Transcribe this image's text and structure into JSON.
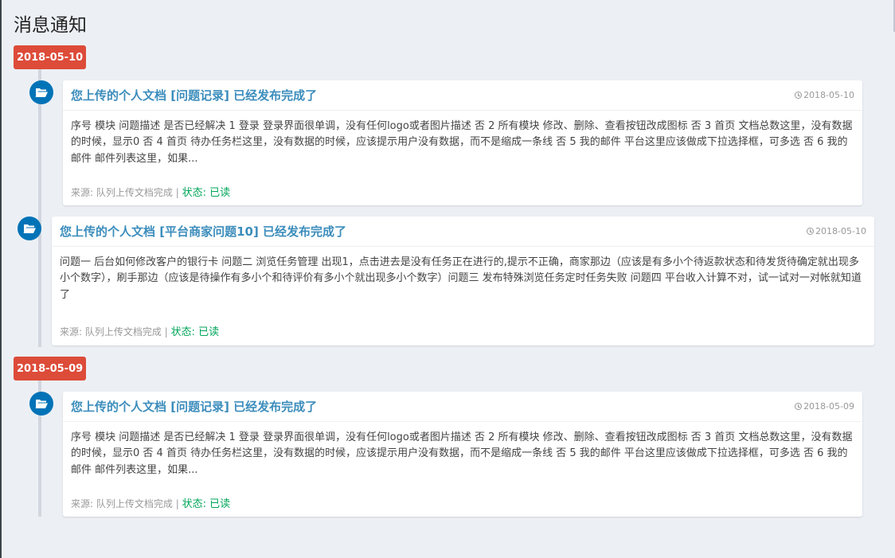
{
  "page": {
    "title": "消息通知"
  },
  "groups": [
    {
      "date": "2018-05-10"
    },
    {
      "date": "2018-05-09"
    }
  ],
  "items": [
    {
      "title": "您上传的个人文档 [问题记录] 已经发布完成了",
      "time": "2018-05-10",
      "body": "序号 模块 问题描述 是否已经解决 1 登录 登录界面很单调，没有任何logo或者图片描述 否 2 所有模块 修改、删除、查看按钮改成图标 否 3 首页 文档总数这里，没有数据的时候，显示0 否 4 首页 待办任务栏这里，没有数据的时候，应该提示用户没有数据，而不是缩成一条线 否 5 我的邮件 平台这里应该做成下拉选择框，可多选 否 6 我的邮件 邮件列表这里，如果...",
      "source": "来源: 队列上传文档完成",
      "separator": "|",
      "status": "状态: 已读"
    },
    {
      "title": "您上传的个人文档 [平台商家问题10] 已经发布完成了",
      "time": "2018-05-10",
      "body": "问题一 后台如何修改客户的银行卡 问题二 浏览任务管理 出现1，点击进去是没有任务正在进行的,提示不正确，商家那边（应该是有多小个待返款状态和待发货待确定就出现多小个数字），刷手那边（应该是待操作有多小个和待评价有多小个就出现多小个数字）问题三 发布特殊浏览任务定时任务失败 问题四 平台收入计算不对，试一试对一对帐就知道了",
      "source": "来源: 队列上传文档完成",
      "separator": "|",
      "status": "状态: 已读"
    },
    {
      "title": "您上传的个人文档 [问题记录] 已经发布完成了",
      "time": "2018-05-09",
      "body": "序号 模块 问题描述 是否已经解决 1 登录 登录界面很单调，没有任何logo或者图片描述 否 2 所有模块 修改、删除、查看按钮改成图标 否 3 首页 文档总数这里，没有数据的时候，显示0 否 4 首页 待办任务栏这里，没有数据的时候，应该提示用户没有数据，而不是缩成一条线 否 5 我的邮件 平台这里应该做成下拉选择框，可多选 否 6 我的邮件 邮件列表这里，如果...",
      "source": "来源: 队列上传文档完成",
      "separator": "|",
      "status": "状态: 已读"
    }
  ],
  "colors": {
    "badge": "#dd4b39",
    "icon": "#0073b7",
    "title": "#3c8dbc",
    "status": "#00a65a"
  },
  "icons": {
    "item": "folder-open-icon",
    "time": "clock-icon"
  }
}
